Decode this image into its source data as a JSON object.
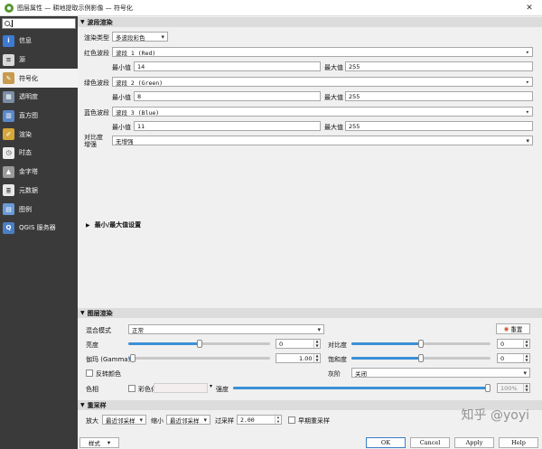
{
  "window": {
    "title": "图层属性 — 耕地提取示例影像 — 符号化"
  },
  "search": {
    "value": ""
  },
  "sidebar": {
    "items": [
      {
        "label": "信息",
        "icon": "info-icon",
        "color": "#3d7bd3"
      },
      {
        "label": "源",
        "icon": "source-icon",
        "color": "#d8d8d8"
      },
      {
        "label": "符号化",
        "icon": "symbology-icon",
        "color": "#c89a4e"
      },
      {
        "label": "透明度",
        "icon": "transparency-icon",
        "color": "#7a8fa6"
      },
      {
        "label": "直方图",
        "icon": "histogram-icon",
        "color": "#5b86c7"
      },
      {
        "label": "渲染",
        "icon": "rendering-icon",
        "color": "#d6a73a"
      },
      {
        "label": "时态",
        "icon": "clock-icon",
        "color": "#ececec"
      },
      {
        "label": "金字塔",
        "icon": "pyramid-icon",
        "color": "#9a9a9a"
      },
      {
        "label": "元数据",
        "icon": "metadata-icon",
        "color": "#e8e8e8"
      },
      {
        "label": "图例",
        "icon": "legend-icon",
        "color": "#6a9bd8"
      },
      {
        "label": "QGIS 服务器",
        "icon": "server-icon",
        "color": "#4b7fc4"
      }
    ],
    "active_index": 2
  },
  "band_render": {
    "header": "波段渲染",
    "render_type_label": "渲染类型",
    "render_type": "多波段彩色",
    "red_label": "红色波段",
    "red_band": "波段 1 (Red)",
    "green_label": "绿色波段",
    "green_band": "波段 2 (Green)",
    "blue_label": "蓝色波段",
    "blue_band": "波段 3 (Blue)",
    "min_label": "最小值",
    "max_label": "最大值",
    "red_min": "14",
    "red_max": "255",
    "green_min": "8",
    "green_max": "255",
    "blue_min": "11",
    "blue_max": "255",
    "contrast_label_1": "对比度",
    "contrast_label_2": "增强",
    "contrast_value": "无增强",
    "minmax_settings": "最小/最大值设置"
  },
  "layer_render": {
    "header": "图层渲染",
    "blend_label": "混合模式",
    "blend_value": "正常",
    "reset_label": "重置",
    "brightness_label": "亮度",
    "brightness_value": "0",
    "contrast_label": "对比度",
    "contrast_value": "0",
    "gamma_label": "伽玛 (Gamma)",
    "gamma_value": "1.00",
    "saturation_label": "饱和度",
    "saturation_value": "0",
    "invert_label": "反转颜色",
    "grayscale_label": "灰阶",
    "grayscale_value": "关闭",
    "hue_label": "色相",
    "colorize_label": "彩色化",
    "strength_label": "强度",
    "strength_value": "100%",
    "brightness_level": 0.5,
    "contrast_level": 0.5,
    "gamma_level": 0.03,
    "saturation_level": 0.5
  },
  "resampling": {
    "header": "重采样",
    "zoom_in_label": "放大",
    "zoom_in_value": "最近邻采样",
    "zoom_out_label": "缩小",
    "zoom_out_value": "最近邻采样",
    "oversampling_label": "过采样",
    "oversampling_value": "2.00",
    "early_resampling_label": "早期重采样"
  },
  "footer": {
    "style_label": "样式",
    "ok_label": "OK",
    "cancel_label": "Cancel",
    "apply_label": "Apply",
    "help_label": "Help"
  },
  "watermark": "知乎 @yoyi"
}
